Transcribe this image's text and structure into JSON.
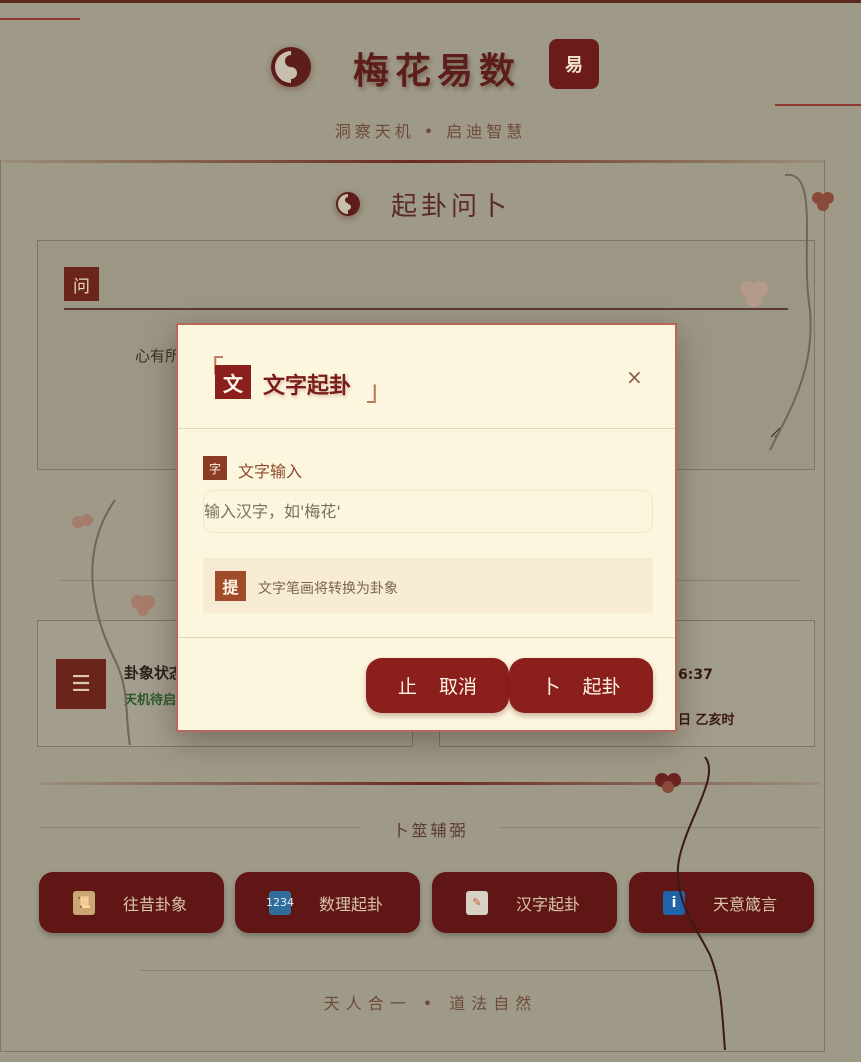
{
  "header": {
    "title": "梅花易数",
    "seal": "易",
    "subtitle": "洞察天机 • 启迪智慧"
  },
  "divination": {
    "title": "起卦问卜",
    "ask_badge": "问",
    "ask_placeholder": "心有所"
  },
  "status_card": {
    "title": "卦象状态",
    "status": "天机待启"
  },
  "time_card": {
    "time": "6:37",
    "date": "日 乙亥时"
  },
  "tools": {
    "title": "卜筮辅弼",
    "buttons": [
      {
        "label": "往昔卦象",
        "icon": "scroll-icon"
      },
      {
        "label": "数理起卦",
        "icon": "numbers-icon"
      },
      {
        "label": "汉字起卦",
        "icon": "memo-icon"
      },
      {
        "label": "天意箴言",
        "icon": "info-icon"
      }
    ]
  },
  "footer": {
    "text": "天人合一 • 道法自然"
  },
  "modal": {
    "icon_char": "文",
    "title": "文字起卦",
    "close": "×",
    "field_badge": "字",
    "field_label": "文字输入",
    "input_placeholder": "输入汉字，如'梅花'",
    "input_value": "",
    "tip_badge": "提",
    "tip_text": "文字笔画将转换为卦象",
    "cancel_icon": "止",
    "cancel_label": "取消",
    "ok_icon": "卜",
    "ok_label": "起卦"
  },
  "colors": {
    "accent": "#8b1f1c",
    "overlay": "#9f9a88",
    "modal_bg": "#fdf6df"
  }
}
